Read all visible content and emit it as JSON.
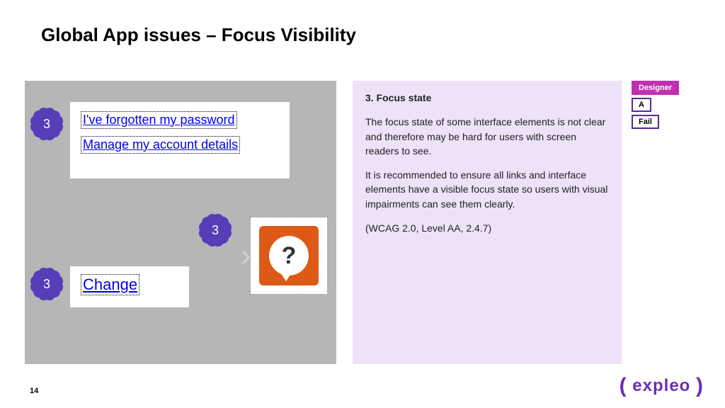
{
  "title": "Global App issues – Focus Visibility",
  "badges": {
    "b1": "3",
    "b2": "3",
    "b3": "3"
  },
  "links": {
    "forgot": "I've forgotten my password",
    "manage": "Manage my account details",
    "change": "Change"
  },
  "qmark": "?",
  "issue": {
    "heading": "3. Focus state",
    "p1": "The focus state of some interface elements is not clear and therefore may be hard for users with screen readers to see.",
    "p2": "It is recommended to ensure all links and interface elements have a visible focus state so users with visual impairments can see them clearly.",
    "p3": "(WCAG 2.0, Level AA, 2.4.7)"
  },
  "tags": {
    "designer": "Designer",
    "level": "A",
    "status": "Fail"
  },
  "page": "14",
  "brand": {
    "open": "(",
    "name": "expleo",
    "close": ")"
  }
}
